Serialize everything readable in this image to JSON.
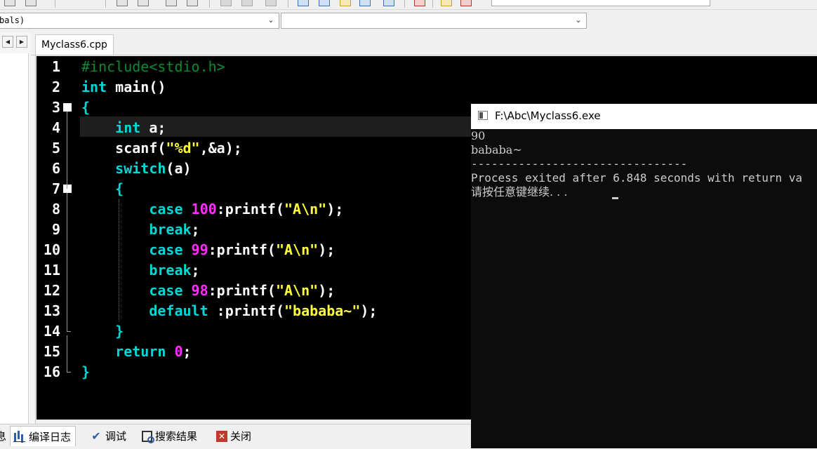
{
  "toolbar": {
    "buttons": [
      "new-file-icon",
      "open-file-icon",
      "save-icon",
      "save-all-icon",
      "print-icon",
      "undo-icon",
      "redo-icon",
      "stop-icon",
      "class-browser-icon",
      "grid-icon",
      "chart-icon",
      "check-icon",
      "delete-icon",
      "bar-chart-icon"
    ]
  },
  "combos": {
    "scope": "bals)",
    "members": ""
  },
  "nav": {
    "left": "◀",
    "right": "▶"
  },
  "tabs": [
    {
      "label": "Myclass6.cpp"
    }
  ],
  "editor": {
    "line_numbers": [
      "1",
      "2",
      "3",
      "4",
      "5",
      "6",
      "7",
      "8",
      "9",
      "10",
      "11",
      "12",
      "13",
      "14",
      "15",
      "16"
    ],
    "lines": [
      [
        {
          "t": "pre",
          "v": "#include<stdio.h>"
        }
      ],
      [
        {
          "t": "kw",
          "v": "int"
        },
        {
          "t": "fn",
          "v": " main()"
        }
      ],
      [
        {
          "t": "brace",
          "v": "{"
        }
      ],
      [
        {
          "t": "fn",
          "v": "    "
        },
        {
          "t": "kw",
          "v": "int"
        },
        {
          "t": "fn",
          "v": " a;"
        }
      ],
      [
        {
          "t": "fn",
          "v": "    scanf("
        },
        {
          "t": "str",
          "v": "\"%d\""
        },
        {
          "t": "fn",
          "v": ",&a);"
        }
      ],
      [
        {
          "t": "fn",
          "v": "    "
        },
        {
          "t": "kw",
          "v": "switch"
        },
        {
          "t": "fn",
          "v": "(a)"
        }
      ],
      [
        {
          "t": "fn",
          "v": "    "
        },
        {
          "t": "brace",
          "v": "{"
        }
      ],
      [
        {
          "t": "fn",
          "v": "        "
        },
        {
          "t": "kw",
          "v": "case"
        },
        {
          "t": "fn",
          "v": " "
        },
        {
          "t": "num",
          "v": "100"
        },
        {
          "t": "fn",
          "v": ":printf("
        },
        {
          "t": "str",
          "v": "\"A\\n\""
        },
        {
          "t": "fn",
          "v": ");"
        }
      ],
      [
        {
          "t": "fn",
          "v": "        "
        },
        {
          "t": "kw",
          "v": "break"
        },
        {
          "t": "fn",
          "v": ";"
        }
      ],
      [
        {
          "t": "fn",
          "v": "        "
        },
        {
          "t": "kw",
          "v": "case"
        },
        {
          "t": "fn",
          "v": " "
        },
        {
          "t": "num",
          "v": "99"
        },
        {
          "t": "fn",
          "v": ":printf("
        },
        {
          "t": "str",
          "v": "\"A\\n\""
        },
        {
          "t": "fn",
          "v": ");"
        }
      ],
      [
        {
          "t": "fn",
          "v": "        "
        },
        {
          "t": "kw",
          "v": "break"
        },
        {
          "t": "fn",
          "v": ";"
        }
      ],
      [
        {
          "t": "fn",
          "v": "        "
        },
        {
          "t": "kw",
          "v": "case"
        },
        {
          "t": "fn",
          "v": " "
        },
        {
          "t": "num",
          "v": "98"
        },
        {
          "t": "fn",
          "v": ":printf("
        },
        {
          "t": "str",
          "v": "\"A\\n\""
        },
        {
          "t": "fn",
          "v": ");"
        }
      ],
      [
        {
          "t": "fn",
          "v": "        "
        },
        {
          "t": "kw",
          "v": "default"
        },
        {
          "t": "fn",
          "v": " :printf("
        },
        {
          "t": "str",
          "v": "\"bababa~\""
        },
        {
          "t": "fn",
          "v": ");"
        }
      ],
      [
        {
          "t": "fn",
          "v": "    "
        },
        {
          "t": "brace",
          "v": "}"
        }
      ],
      [
        {
          "t": "fn",
          "v": "    "
        },
        {
          "t": "kw",
          "v": "return"
        },
        {
          "t": "fn",
          "v": " "
        },
        {
          "t": "num",
          "v": "0"
        },
        {
          "t": "fn",
          "v": ";"
        }
      ],
      [
        {
          "t": "brace",
          "v": "}"
        }
      ]
    ],
    "current_line": 4,
    "colors": {
      "preprocessor": "#0a8a35",
      "keyword": "#00d7d7",
      "string": "#ffff3c",
      "number": "#ff2cff",
      "text": "#ffffff",
      "background": "#000000"
    }
  },
  "console": {
    "title": "F:\\Abc\\Myclass6.exe",
    "lines": [
      "90",
      "bababa~",
      "--------------------------------",
      "Process exited after 6.848 seconds with return va",
      "请按任意键继续. . . "
    ]
  },
  "bottom_tabs": [
    {
      "label": "编译日志",
      "icon": "log-chart-icon"
    },
    {
      "label": "调试",
      "icon": "debug-check-icon"
    },
    {
      "label": "搜索结果",
      "icon": "search-results-icon"
    },
    {
      "label": "关闭",
      "icon": "close-icon"
    }
  ],
  "bottom_partial": "息"
}
